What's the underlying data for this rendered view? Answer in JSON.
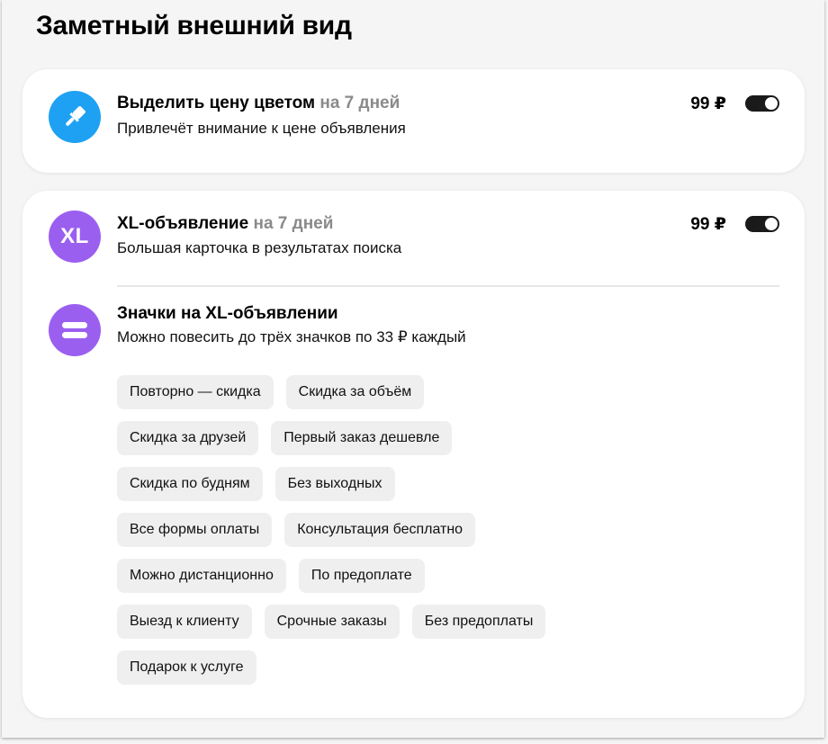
{
  "page": {
    "title": "Заметный внешний вид"
  },
  "colors": {
    "accent_blue": "#1ea1f2",
    "accent_purple": "#9b5ff0",
    "toggle_on": "#1a1a1a",
    "chip_bg": "#efefef"
  },
  "options": [
    {
      "icon": "brush-icon",
      "title": "Выделить цену цветом",
      "duration": "на 7 дней",
      "subtitle": "Привлечёт внимание к цене объявления",
      "price": "99 ₽",
      "enabled": true
    },
    {
      "icon": "xl-icon",
      "icon_text": "XL",
      "title": "XL-объявление",
      "duration": "на 7 дней",
      "subtitle": "Большая карточка в результатах поиска",
      "price": "99 ₽",
      "enabled": true
    }
  ],
  "badges": {
    "icon": "badge-icon",
    "title": "Значки на XL-объявлении",
    "subtitle": "Можно повесить до трёх значков по 33 ₽ каждый",
    "rows": [
      [
        "Повторно — скидка",
        "Скидка за объём"
      ],
      [
        "Скидка за друзей",
        "Первый заказ дешевле"
      ],
      [
        "Скидка по будням",
        "Без выходных"
      ],
      [
        "Все формы оплаты",
        "Консультация бесплатно"
      ],
      [
        "Можно дистанционно",
        "По предоплате"
      ],
      [
        "Выезд к клиенту",
        "Срочные заказы",
        "Без предоплаты"
      ],
      [
        "Подарок к услуге"
      ]
    ]
  }
}
